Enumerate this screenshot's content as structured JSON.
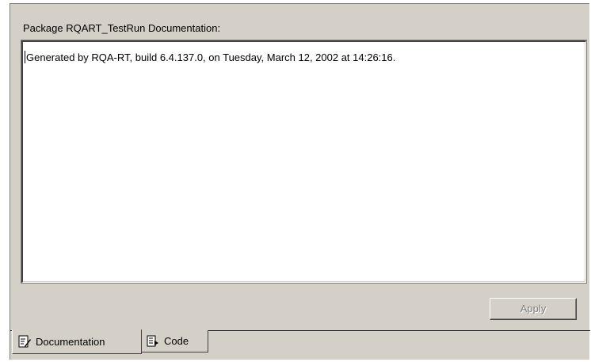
{
  "panel": {
    "documentation_label": "Package RQART_TestRun Documentation:",
    "documentation_text": "Generated by RQA-RT, build 6.4.137.0, on Tuesday, March 12, 2002 at 14:26:16."
  },
  "buttons": {
    "apply_label": "Apply",
    "apply_enabled": false
  },
  "tabs": [
    {
      "label": "Documentation",
      "icon": "document-edit-icon",
      "active": true
    },
    {
      "label": "Code",
      "icon": "code-file-icon",
      "active": false
    }
  ],
  "colors": {
    "window_background": "#d4d0c8",
    "text_area_background": "#ffffff",
    "disabled_text": "#808080"
  }
}
